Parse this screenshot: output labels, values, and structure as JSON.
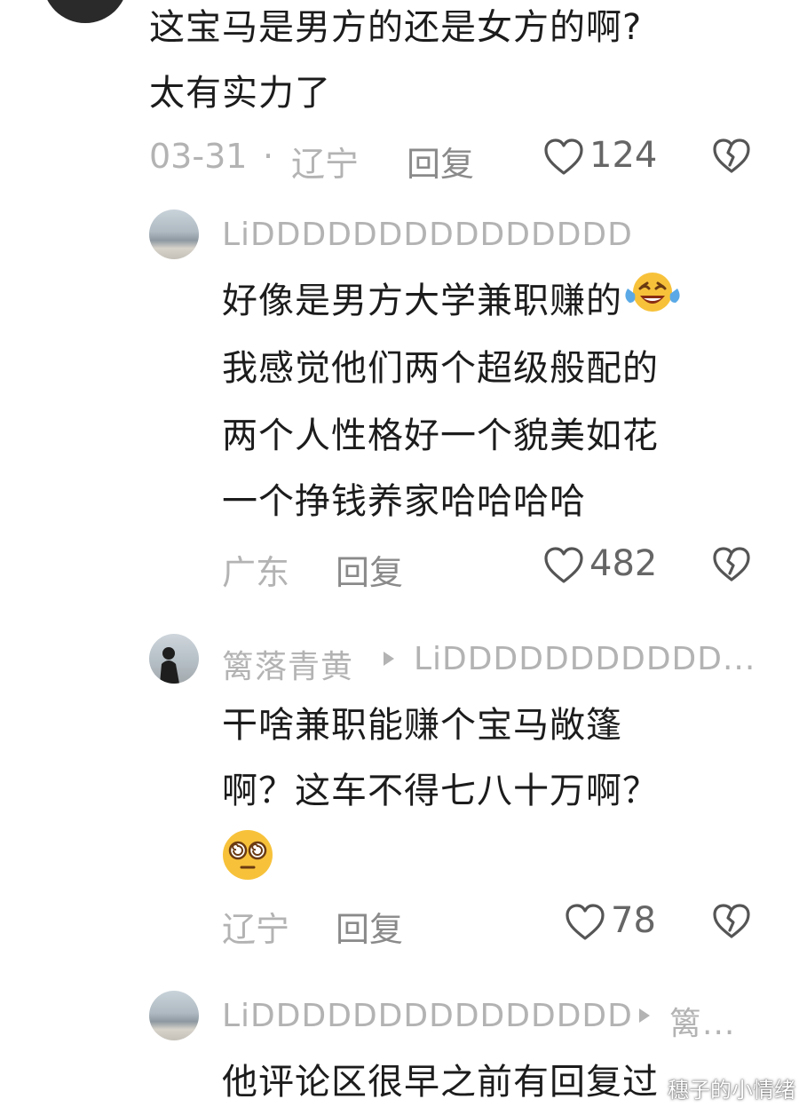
{
  "comments": [
    {
      "text_lines": [
        "这宝马是男方的还是女方的啊?",
        "太有实力了"
      ],
      "date": "03-31",
      "separator": "·",
      "location": "辽宁",
      "reply_label": "回复",
      "likes": "124"
    },
    {
      "username": "LiDDDDDDDDDDDDDDD",
      "text_lines": [
        "好像是男方大学兼职赚的",
        "我感觉他们两个超级般配的",
        "两个人性格好一个貌美如花",
        "一个挣钱养家哈哈哈哈"
      ],
      "location": "广东",
      "reply_label": "回复",
      "likes": "482",
      "emoji": "laughing-crying-emoji"
    },
    {
      "username": "篱落青黄",
      "reply_to": "LiDDDDDDDDDDD...",
      "text_lines": [
        "干啥兼职能赚个宝马敞篷",
        "啊？这车不得七八十万啊？"
      ],
      "location": "辽宁",
      "reply_label": "回复",
      "likes": "78",
      "emoji": "dizzy-face-emoji"
    },
    {
      "username": "LiDDDDDDDDDDDDDDD",
      "reply_to": "篱...",
      "text_lines": [
        "他评论区很早之前有回复过"
      ]
    }
  ],
  "watermark": "穗子的小情绪",
  "icons": {
    "like": "heart-outline-icon",
    "dislike": "broken-heart-icon",
    "reply_arrow": "play-arrow-icon"
  },
  "colors": {
    "text": "#1c1c1c",
    "muted": "#b3b3b3",
    "reply": "#8a8a8a",
    "count": "#666666",
    "icon": "#555555",
    "background": "#ffffff"
  }
}
